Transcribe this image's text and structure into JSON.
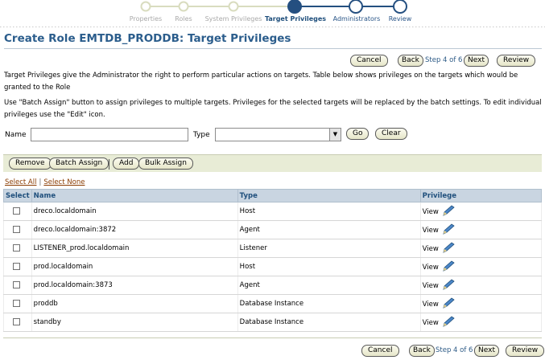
{
  "train": {
    "steps": [
      {
        "label": "Properties",
        "state": "done"
      },
      {
        "label": "Roles",
        "state": "done"
      },
      {
        "label": "System Privileges",
        "state": "done"
      },
      {
        "label": "Target Privileges",
        "state": "current"
      },
      {
        "label": "Administrators",
        "state": "todo"
      },
      {
        "label": "Review",
        "state": "todo"
      }
    ],
    "colors": {
      "done": "#d9dcbf",
      "current": "#244f80",
      "todo": "#244f80"
    }
  },
  "page": {
    "title": "Create Role EMTDB_PRODDB: Target Privileges",
    "description": "Target Privileges give the Administrator the right to perform particular actions on targets. Table below shows privileges on the targets which would be granted to the Role",
    "instructions": "Use \"Batch Assign\" button to assign privileges to multiple targets. Privileges for the selected targets will be replaced by the batch settings. To edit individual privileges use the \"Edit\" icon."
  },
  "nav": {
    "cancel": "Cancel",
    "back": "Back",
    "step_info": "Step 4 of 6",
    "next": "Next",
    "review": "Review"
  },
  "search": {
    "name_label": "Name",
    "name_value": "",
    "type_label": "Type",
    "type_value": "",
    "go": "Go",
    "clear": "Clear"
  },
  "toolbar": {
    "remove": "Remove",
    "batch_assign": "Batch Assign",
    "add": "Add",
    "bulk_assign": "Bulk Assign"
  },
  "selection": {
    "select_all": "Select All",
    "select_none": "Select None"
  },
  "table": {
    "headers": {
      "select": "Select",
      "name": "Name",
      "type": "Type",
      "privilege": "Privilege"
    },
    "rows": [
      {
        "name": "dreco.localdomain",
        "type": "Host",
        "privilege": "View"
      },
      {
        "name": "dreco.localdomain:3872",
        "type": "Agent",
        "privilege": "View"
      },
      {
        "name": "LISTENER_prod.localdomain",
        "type": "Listener",
        "privilege": "View"
      },
      {
        "name": "prod.localdomain",
        "type": "Host",
        "privilege": "View"
      },
      {
        "name": "prod.localdomain:3873",
        "type": "Agent",
        "privilege": "View"
      },
      {
        "name": "proddb",
        "type": "Database Instance",
        "privilege": "View"
      },
      {
        "name": "standby",
        "type": "Database Instance",
        "privilege": "View"
      }
    ],
    "edit_icon": "pencil-icon"
  }
}
